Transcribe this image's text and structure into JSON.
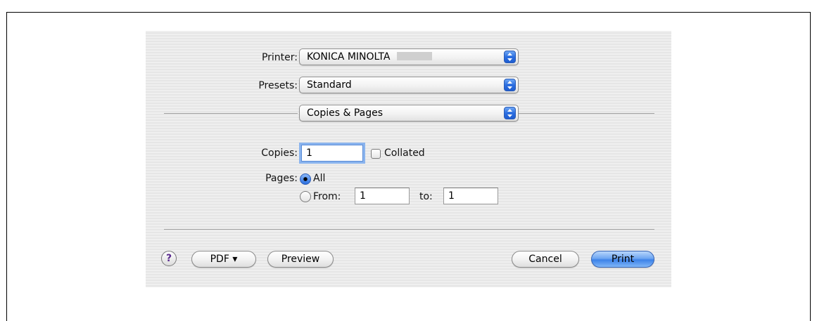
{
  "printer": {
    "label": "Printer:",
    "value": "KONICA MINOLTA"
  },
  "presets": {
    "label": "Presets:",
    "value": "Standard"
  },
  "panel": {
    "value": "Copies & Pages"
  },
  "copies": {
    "label": "Copies:",
    "value": "1",
    "collated_label": "Collated",
    "collated_checked": false
  },
  "pages": {
    "label": "Pages:",
    "all_label": "All",
    "all_selected": true,
    "from_label": "From:",
    "from_value": "1",
    "to_label": "to:",
    "to_value": "1"
  },
  "buttons": {
    "help": "?",
    "pdf": "PDF ▾",
    "preview": "Preview",
    "cancel": "Cancel",
    "print": "Print"
  },
  "colors": {
    "accent": "#3d82e8",
    "help": "#5a2a8e"
  }
}
